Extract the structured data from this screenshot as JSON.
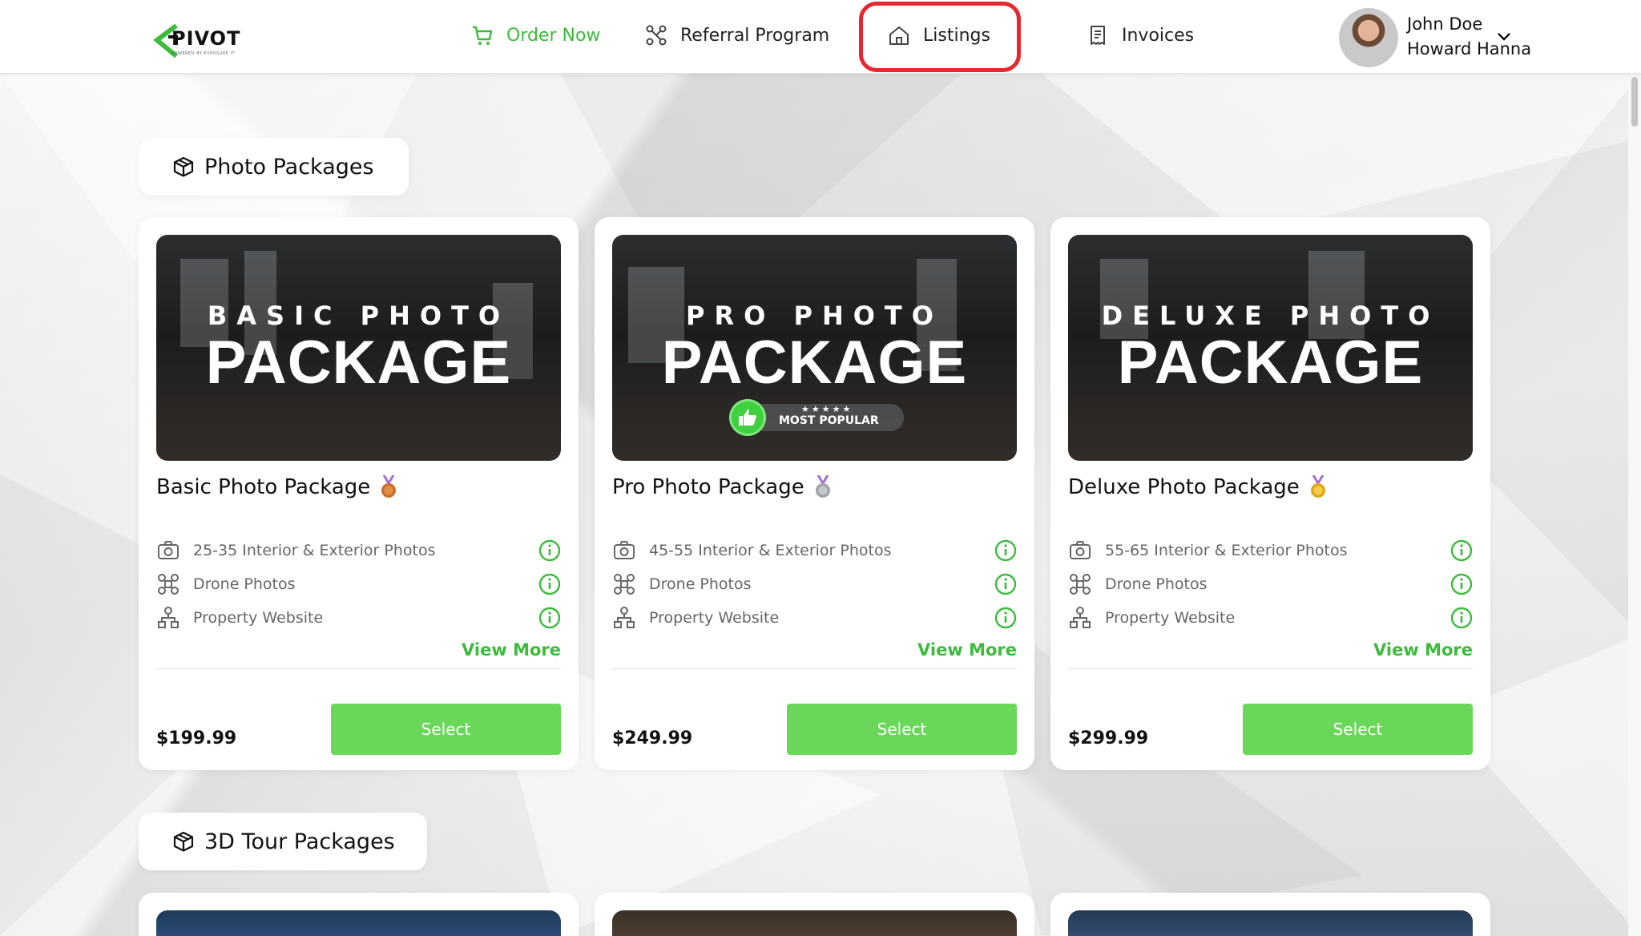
{
  "header": {
    "logo_text": "PIVOT",
    "logo_sub": "POWERED BY EXPOSURE IT",
    "nav": [
      {
        "label": "Order Now",
        "icon": "cart-icon",
        "active": true
      },
      {
        "label": "Referral Program",
        "icon": "share-nodes-icon"
      },
      {
        "label": "Listings",
        "icon": "house-icon"
      },
      {
        "label": "Invoices",
        "icon": "receipt-icon"
      }
    ],
    "user": {
      "name": "John Doe",
      "company": "Howard Hanna"
    }
  },
  "colors": {
    "accent": "#3dbb3d",
    "button": "#6ad75a",
    "highlight": "#e8262f"
  },
  "sections": [
    {
      "title": "Photo Packages",
      "icon": "box-icon"
    },
    {
      "title": "3D Tour Packages",
      "icon": "box-icon"
    }
  ],
  "packages": [
    {
      "image_top": "BASIC PHOTO",
      "image_big": "PACKAGE",
      "title": "Basic Photo Package",
      "medal": "bronze-medal-icon",
      "features": [
        "25-35 Interior & Exterior Photos",
        "Drone Photos",
        "Property Website"
      ],
      "view_more": "View More",
      "price": "$199.99",
      "select": "Select"
    },
    {
      "image_top": "PRO PHOTO",
      "image_big": "PACKAGE",
      "badge_stars": "★★★★★",
      "badge_text": "MOST POPULAR",
      "title": "Pro Photo Package",
      "medal": "silver-medal-icon",
      "features": [
        "45-55 Interior & Exterior Photos",
        "Drone Photos",
        "Property Website"
      ],
      "view_more": "View More",
      "price": "$249.99",
      "select": "Select"
    },
    {
      "image_top": "DELUXE PHOTO",
      "image_big": "PACKAGE",
      "title": "Deluxe Photo Package",
      "medal": "gold-medal-icon",
      "features": [
        "55-65 Interior & Exterior Photos",
        "Drone Photos",
        "Property Website"
      ],
      "view_more": "View More",
      "price": "$299.99",
      "select": "Select"
    }
  ]
}
